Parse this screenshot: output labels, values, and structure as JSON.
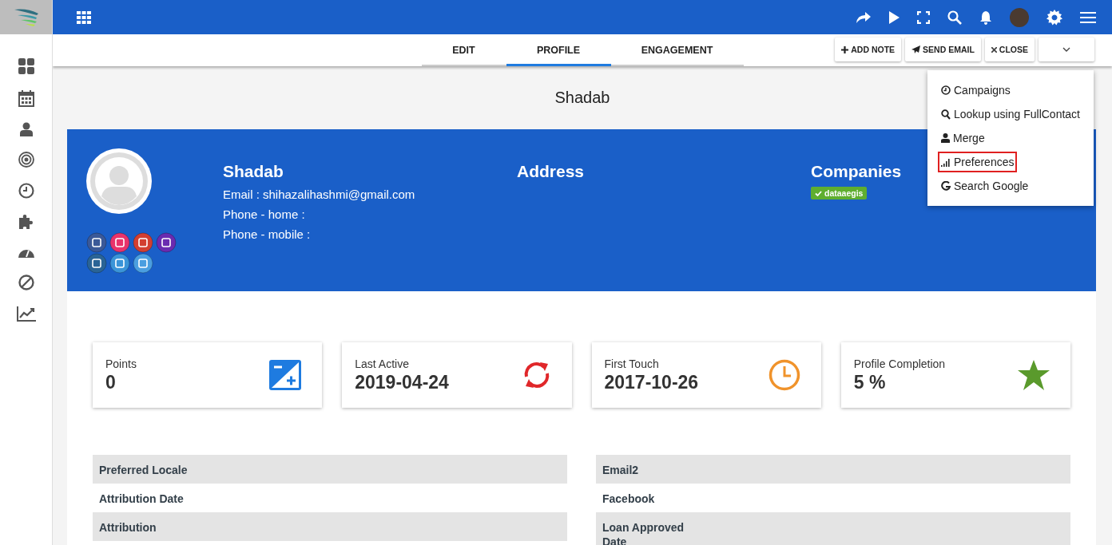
{
  "tabs": [
    {
      "label": "EDIT",
      "selected": false
    },
    {
      "label": "PROFILE",
      "selected": true
    },
    {
      "label": "ENGAGEMENT",
      "selected": false
    }
  ],
  "actions": [
    {
      "label": "ADD NOTE",
      "kind": "plus"
    },
    {
      "label": "SEND EMAIL",
      "kind": "send"
    },
    {
      "label": "CLOSE",
      "kind": "close"
    }
  ],
  "menu": {
    "open": true,
    "items": [
      {
        "label": "Campaigns",
        "kind": "clock",
        "highlighted": false
      },
      {
        "label": "Lookup using FullContact",
        "kind": "search",
        "highlighted": false
      },
      {
        "label": "Merge",
        "kind": "user",
        "highlighted": false
      },
      {
        "label": "Preferences",
        "kind": "bars",
        "highlighted": true
      },
      {
        "label": "Search Google",
        "kind": "google",
        "highlighted": false
      }
    ]
  },
  "page_title": "Shadab",
  "contact": {
    "name": "Shadab",
    "details": [
      "Email : shihazalihashmi@gmail.com",
      "Phone - home :",
      "Phone - mobile :"
    ],
    "address_heading": "Address",
    "companies_heading": "Companies",
    "companies": [
      {
        "label": "dataaegis"
      }
    ]
  },
  "stats": [
    {
      "label": "Points",
      "value": "0",
      "kind": "points"
    },
    {
      "label": "Last Active",
      "value": "2019-04-24",
      "kind": "refresh"
    },
    {
      "label": "First Touch",
      "value": "2017-10-26",
      "kind": "clock"
    },
    {
      "label": "Profile Completion",
      "value": "5 %",
      "kind": "star"
    }
  ],
  "fields": {
    "left": [
      "Preferred Locale",
      "Attribution Date",
      "Attribution"
    ],
    "right": [
      "Email2",
      "Facebook",
      "Loan Approved Date"
    ]
  }
}
